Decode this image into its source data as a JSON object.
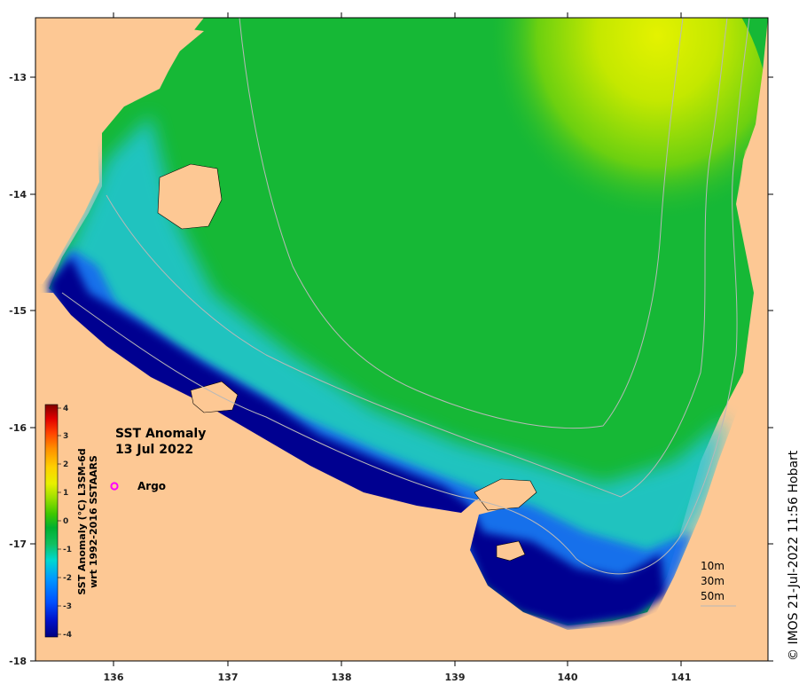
{
  "title": {
    "line1": "SST Anomaly",
    "line2": "13 Jul 2022"
  },
  "legend": {
    "argo_label": "Argo",
    "argo_color": "#ff00ff"
  },
  "depth_contours": [
    "10m",
    "30m",
    "50m"
  ],
  "credit": "© IMOS 21-Jul-2022 11:56 Hobart",
  "colorbar": {
    "title_line1": "SST Anomaly (°C) L3SM-6d",
    "title_line2": "wrt 1992-2016 SSTAARS",
    "ticks": [
      "4",
      "3",
      "2",
      "1",
      "0",
      "-1",
      "-2",
      "-3",
      "-4"
    ],
    "range": [
      -4,
      4
    ],
    "colors": [
      "#000080",
      "#0010c8",
      "#0050ff",
      "#0098ff",
      "#00d8d0",
      "#10c060",
      "#00b030",
      "#40c800",
      "#a0e000",
      "#e8f000",
      "#ffd000",
      "#ff9000",
      "#ff4000",
      "#e00000",
      "#800000"
    ]
  },
  "axes": {
    "lon_ticks": [
      "136",
      "137",
      "138",
      "139",
      "140",
      "141"
    ],
    "lat_ticks": [
      "-13",
      "-14",
      "-15",
      "-16",
      "-17",
      "-18"
    ]
  },
  "colors": {
    "land": "#fdc894",
    "deep_anomaly": "#00008c",
    "cold_anomaly": "#0a5cff",
    "cyan": "#18c8e0",
    "green": "#16b836",
    "yellow_green": "#c8e800",
    "contour": "#b8b8b8"
  }
}
